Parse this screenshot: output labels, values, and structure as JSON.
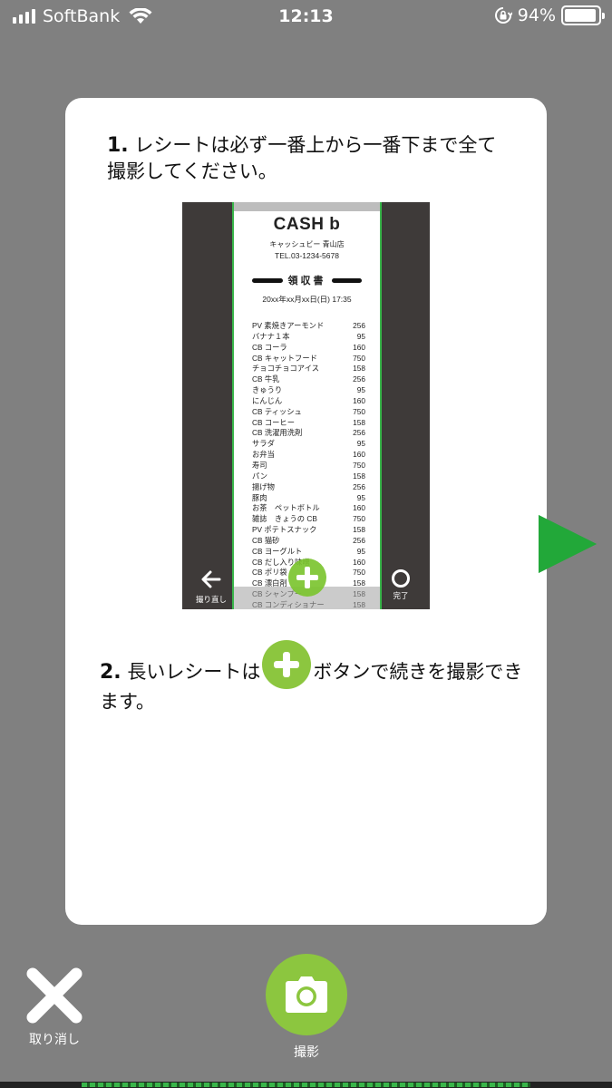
{
  "status_bar": {
    "carrier": "SoftBank",
    "time": "12:13",
    "battery": "94%",
    "battery_level": 0.94,
    "icons": [
      "signal-icon",
      "wifi-icon",
      "rotation-lock-icon",
      "battery-icon"
    ]
  },
  "card": {
    "step1": {
      "number": "1.",
      "text": "レシートは必ず一番上から一番下まで全て撮影してください。"
    },
    "preview": {
      "receipt": {
        "logo": "CASH b",
        "store": "キャッシュビー 青山店",
        "tel": "TEL.03-1234-5678",
        "title": "領収書",
        "date": "20xx年xx月xx日(日)  17:35",
        "items": [
          {
            "name": "PV 素焼きアーモンド",
            "price": "256"
          },
          {
            "name": "バナナ１本",
            "price": "95"
          },
          {
            "name": "CB コーラ",
            "price": "160"
          },
          {
            "name": "CB キャットフード",
            "price": "750"
          },
          {
            "name": "チョコチョコアイス",
            "price": "158"
          },
          {
            "name": "CB 牛乳",
            "price": "256"
          },
          {
            "name": "きゅうり",
            "price": "95"
          },
          {
            "name": "にんじん",
            "price": "160"
          },
          {
            "name": "CB ティッシュ",
            "price": "750"
          },
          {
            "name": "CB コーヒー",
            "price": "158"
          },
          {
            "name": "CB 洗濯用洗剤",
            "price": "256"
          },
          {
            "name": "サラダ",
            "price": "95"
          },
          {
            "name": "お弁当",
            "price": "160"
          },
          {
            "name": "寿司",
            "price": "750"
          },
          {
            "name": "パン",
            "price": "158"
          },
          {
            "name": "揚げ物",
            "price": "256"
          },
          {
            "name": "豚肉",
            "price": "95"
          },
          {
            "name": "お茶　ペットボトル",
            "price": "160"
          },
          {
            "name": "雑誌　きょうの CB",
            "price": "750"
          },
          {
            "name": "PV ポテトスナック",
            "price": "158"
          },
          {
            "name": "CB 猫砂",
            "price": "256"
          },
          {
            "name": "CB ヨーグルト",
            "price": "95"
          },
          {
            "name": "CB だし入り味噌",
            "price": "160"
          },
          {
            "name": "CB ポリ袋",
            "price": "750"
          },
          {
            "name": "CB 漂白剤",
            "price": "158"
          },
          {
            "name": "CB シャンプー",
            "price": "158"
          },
          {
            "name": "CB コンディショナー",
            "price": "158"
          }
        ]
      },
      "retake_label": "撮り直し",
      "done_label": "完了"
    },
    "step2": {
      "number": "2.",
      "text_before": "長いレシートは",
      "text_after": "ボタンで続きを撮影できます。"
    }
  },
  "controls": {
    "cancel_label": "取り消し",
    "shoot_label": "撮影",
    "accent_color": "#8cc63f",
    "next_color": "#22a839"
  }
}
